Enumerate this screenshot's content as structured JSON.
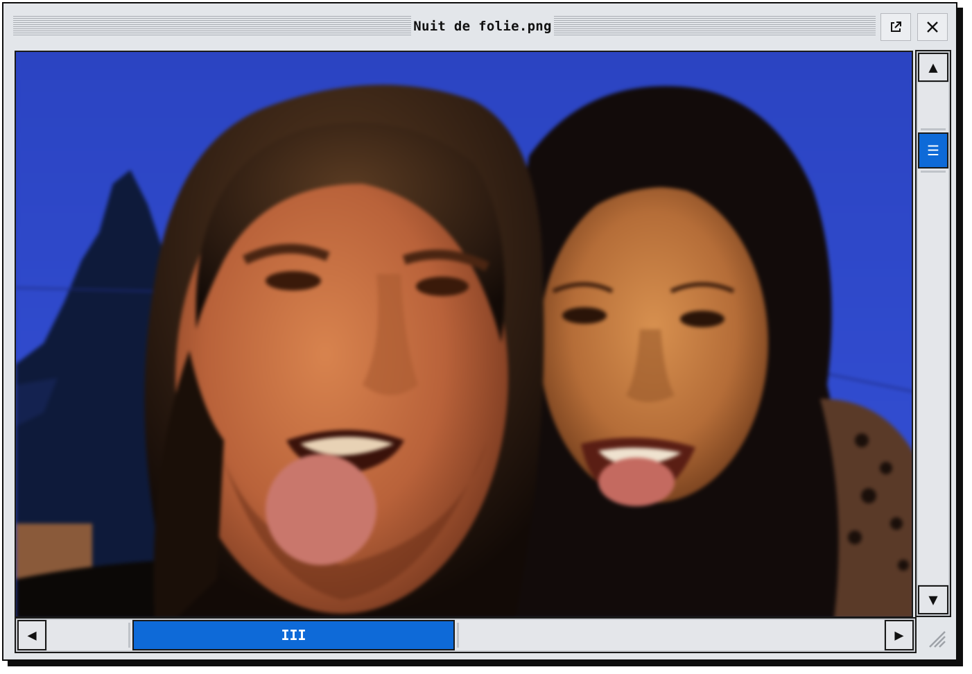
{
  "window": {
    "title": "Nuit de folie.png"
  },
  "titlebar_buttons": {
    "popout_icon": "external-link-icon",
    "close_icon": "close-icon"
  },
  "vertical_scrollbar": {
    "up_glyph": "▲",
    "down_glyph": "▼",
    "thumb_glyph": "☰"
  },
  "horizontal_scrollbar": {
    "left_glyph": "◀",
    "right_glyph": "▶",
    "thumb_glyph": "III"
  },
  "colors": {
    "window_bg": "#e3e6ea",
    "accent": "#0e6ad8",
    "border": "#1a1a1a",
    "photo_sky": "#2d47c4"
  }
}
